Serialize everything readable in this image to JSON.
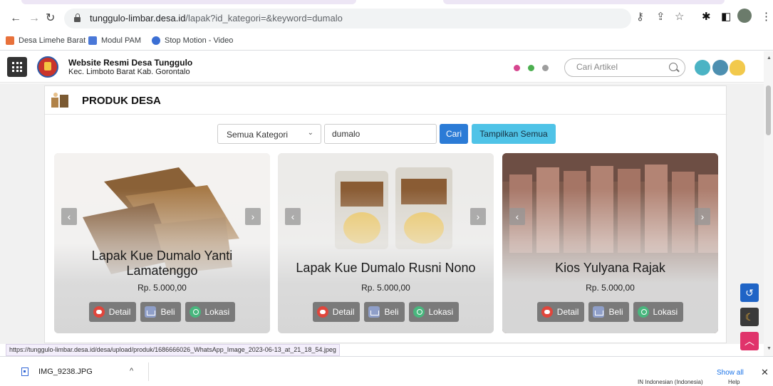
{
  "browser": {
    "url_host": "tunggulo-limbar.desa.id",
    "url_path": "/lapak?id_kategori=&keyword=dumalo",
    "bookmarks": [
      {
        "label": "Desa Limehe Barat",
        "color": "#e8713b"
      },
      {
        "label": "Modul PAM",
        "color": "#4a78d8"
      },
      {
        "label": "Stop Motion - Video",
        "color": "#3b6fd4"
      }
    ]
  },
  "site": {
    "title": "Website Resmi Desa Tunggulo",
    "subtitle": "Kec. Limboto Barat Kab. Gorontalo",
    "search_placeholder": "Cari Artikel",
    "dots": [
      "#d6468f",
      "#4caf50",
      "#9e9e9e"
    ]
  },
  "page": {
    "title": "PRODUK DESA",
    "filter": {
      "category_label": "Semua Kategori",
      "keyword": "dumalo",
      "search_button": "Cari",
      "show_all_button": "Tampilkan Semua"
    },
    "products": [
      {
        "name": "Lapak Kue Dumalo Yanti Lamatenggo",
        "price": "Rp. 5.000,00"
      },
      {
        "name": "Lapak Kue Dumalo Rusni Nono",
        "price": "Rp. 5.000,00"
      },
      {
        "name": "Kios Yulyana Rajak",
        "price": "Rp. 5.000,00"
      }
    ],
    "actions": {
      "detail": "Detail",
      "beli": "Beli",
      "lokasi": "Lokasi"
    }
  },
  "status_url": "https://tunggulo-limbar.desa.id/desa/upload/produk/1686666026_WhatsApp_Image_2023-06-13_at_21_18_54.jpeg",
  "downloads": {
    "file": "IMG_9238.JPG",
    "show_all": "Show all",
    "language": "IN Indonesian (Indonesia)",
    "help": "Help"
  },
  "accent_colors": {
    "search": "#2b7bd6",
    "show_all": "#4fc3e7",
    "to_top": "#e0336b",
    "back": "#1f64c6"
  }
}
